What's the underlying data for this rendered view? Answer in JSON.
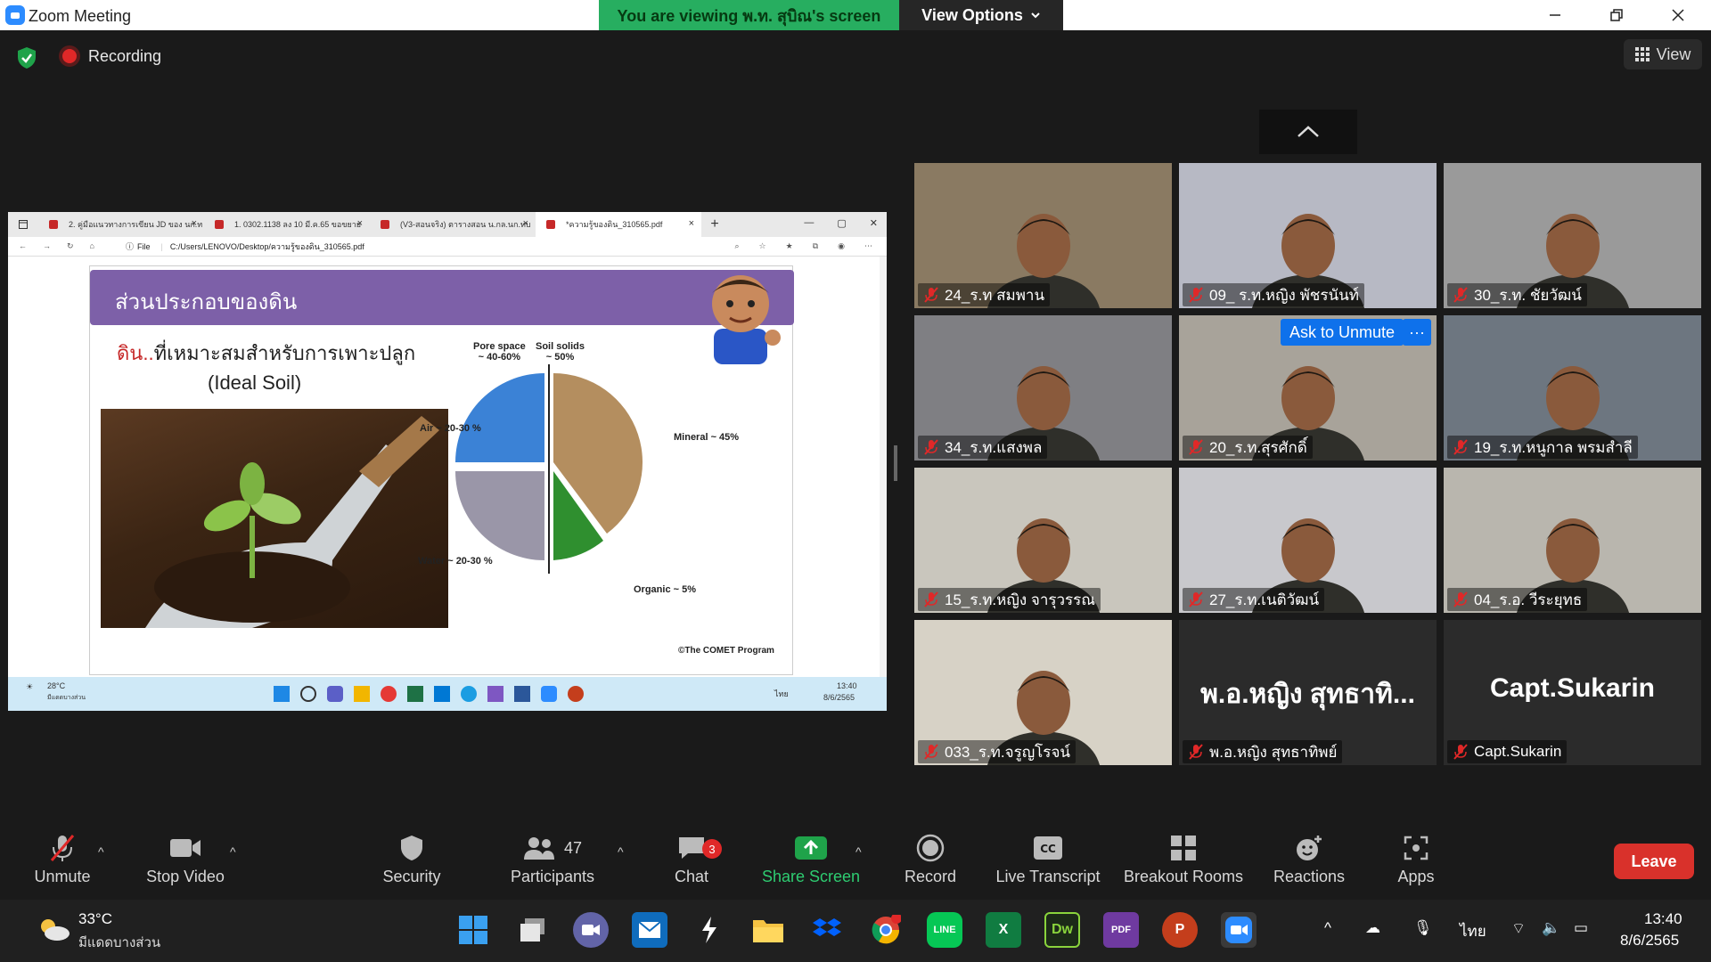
{
  "window": {
    "app_title": "Zoom Meeting"
  },
  "banner": {
    "viewing_text": "You are viewing พ.ท. สุบิณ's screen",
    "view_options": "View Options"
  },
  "status": {
    "recording": "Recording",
    "view": "View"
  },
  "shared_screen": {
    "tabs": [
      {
        "label": "2. คู่มือแนวทางการเขียน JD ของ นก.ท"
      },
      {
        "label": "1. 0302.1138 ลง 10 มี.ค.65 ขอขยาย"
      },
      {
        "label": "(V3-สอนจริง) ตารางสอน น.กล.นก.ทบ"
      },
      {
        "label": "*ความรู้ของดิน_310565.pdf"
      }
    ],
    "address_prefix": "File",
    "address": "C:/Users/LENOVO/Desktop/ความรู้ของดิน_310565.pdf",
    "slide": {
      "title": "ส่วนประกอบของดิน",
      "subtitle_red": "ดิน..",
      "subtitle_rest": "ที่เหมาะสมสำหรับการเพาะปลูก",
      "subtitle2": "(Ideal Soil)",
      "pie_labels": {
        "pore_space": "Pore space",
        "pore_space_pct": "~ 40-60%",
        "soil_solids": "Soil solids",
        "soil_solids_pct": "~ 50%",
        "air": "Air ~ 20-30 %",
        "water": "Water ~ 20-30 %",
        "mineral": "Mineral ~ 45%",
        "organic": "Organic ~ 5%"
      },
      "credit": "©The COMET Program"
    },
    "taskbar": {
      "temp": "28°C",
      "weather": "มีแดดบางส่วน",
      "lang": "ไทย",
      "time": "13:40",
      "date": "8/6/2565"
    }
  },
  "participants": [
    {
      "name": "24_ร.ท สมพาน",
      "bg": "#8a7a62"
    },
    {
      "name": "09_ ร.ท.หญิง พัชรนันท์",
      "bg": "#b7b9c4"
    },
    {
      "name": "30_ร.ท. ชัยวัฒน์",
      "bg": "#9a9a9a"
    },
    {
      "name": "34_ร.ท.แสงพล",
      "bg": "#7f7f83"
    },
    {
      "name": "20_ร.ท.สุรศักดิ์",
      "bg": "#a8a39a"
    },
    {
      "name": "19_ร.ท.หนูกาล  พรมสำลี",
      "bg": "#6d7680"
    },
    {
      "name": "15_ร.ท.หญิง จารุวรรณ",
      "bg": "#c9c6bd"
    },
    {
      "name": "27_ร.ท.เนติวัฒน์",
      "bg": "#c8c8cc"
    },
    {
      "name": "04_ร.อ. วีระยุทธ",
      "bg": "#b9b6ae"
    },
    {
      "name": "033_ร.ท.จรูญโรจน์",
      "bg": "#d7d2c6"
    },
    {
      "name": "พ.อ.หญิง สุทธาทิพย์",
      "big": "พ.อ.หญิง สุทธาทิ...",
      "bg": "#2b2b2b"
    },
    {
      "name": "Capt.Sukarin",
      "big": "Capt.Sukarin",
      "bg": "#2b2b2b"
    }
  ],
  "tile_actions": {
    "ask_unmute": "Ask to Unmute",
    "more": "···"
  },
  "toolbar": {
    "unmute": "Unmute",
    "stop_video": "Stop Video",
    "security": "Security",
    "participants": "Participants",
    "participants_count": "47",
    "chat": "Chat",
    "chat_badge": "3",
    "share_screen": "Share Screen",
    "record": "Record",
    "live_transcript": "Live Transcript",
    "breakout_rooms": "Breakout Rooms",
    "reactions": "Reactions",
    "apps": "Apps",
    "leave": "Leave"
  },
  "windows_taskbar": {
    "temp": "33°C",
    "weather": "มีแดดบางส่วน",
    "lang": "ไทย",
    "time": "13:40",
    "date": "8/6/2565"
  },
  "colors": {
    "zoom_blue": "#0e71eb",
    "leave_red": "#d9312b",
    "banner_green": "#27ae60",
    "muted_red": "#e02828"
  }
}
